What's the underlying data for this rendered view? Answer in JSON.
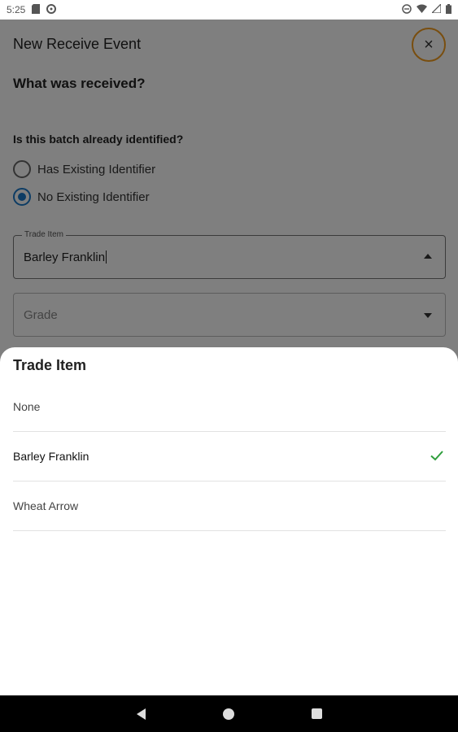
{
  "status_bar": {
    "time": "5:25",
    "icons_left": [
      "sd-card-icon",
      "sync-icon"
    ],
    "icons_right": [
      "do-not-disturb-icon",
      "wifi-icon",
      "cell-signal-icon",
      "battery-icon"
    ]
  },
  "screen": {
    "title": "New Receive Event",
    "close_label": "×",
    "section_title": "What was received?",
    "question": "Is this batch already identified?",
    "radio_options": [
      {
        "label": "Has Existing Identifier",
        "selected": false
      },
      {
        "label": "No Existing Identifier",
        "selected": true
      }
    ],
    "trade_item": {
      "label": "Trade Item",
      "value": "Barley Franklin"
    },
    "grade": {
      "placeholder": "Grade"
    }
  },
  "sheet": {
    "title": "Trade Item",
    "options": [
      {
        "label": "None",
        "selected": false
      },
      {
        "label": "Barley Franklin",
        "selected": true
      },
      {
        "label": "Wheat Arrow",
        "selected": false
      }
    ]
  },
  "colors": {
    "accent": "#1a79c9",
    "close_border": "#f29c1e",
    "check": "#2e9e3c"
  }
}
